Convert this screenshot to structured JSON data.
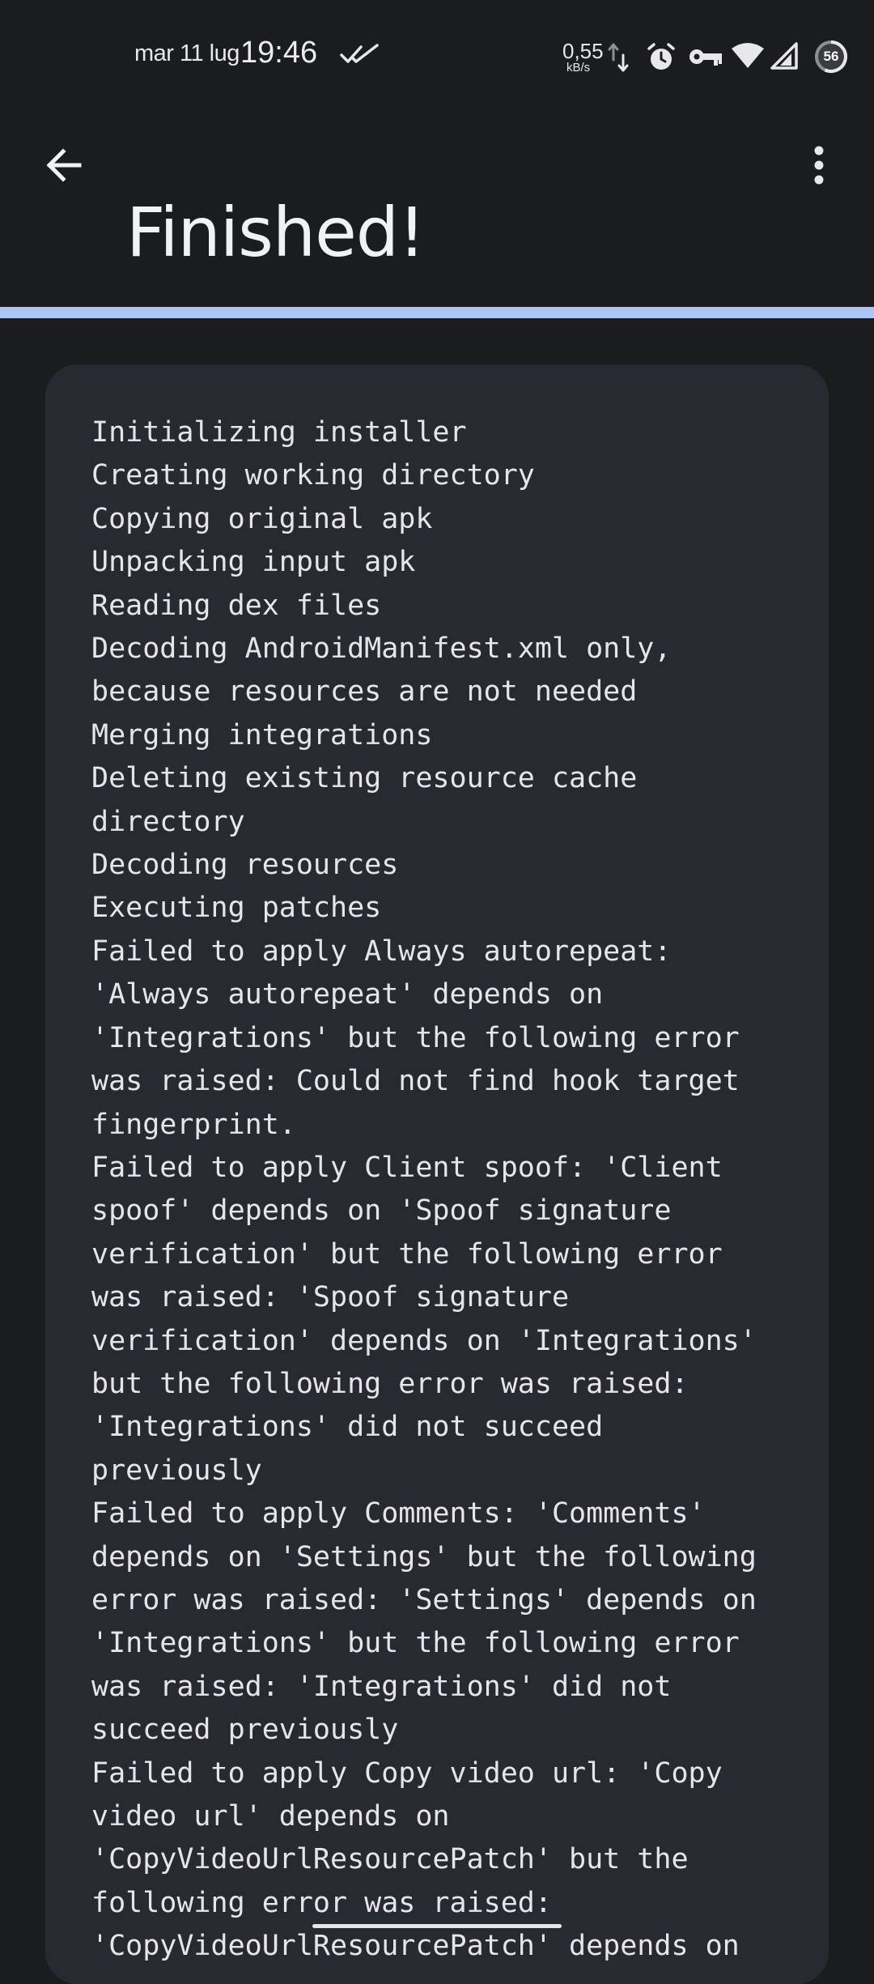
{
  "status_bar": {
    "date": "mar 11 lug",
    "time": "19:46",
    "net_speed_value": "0,55",
    "net_speed_unit": "kB/s",
    "battery_level": "56",
    "icons": [
      "double-check-icon",
      "upload-download-arrows-icon",
      "alarm-icon",
      "vpn-key-icon",
      "wifi-icon",
      "cell-signal-icon",
      "battery-icon"
    ]
  },
  "top_bar": {
    "back_icon": "arrow-back-icon",
    "menu_icon": "more-vert-icon",
    "title": "Finished!"
  },
  "progress": {
    "value": 1.0,
    "fill_color": "#aec6f4"
  },
  "log": {
    "lines": [
      "Initializing installer",
      "Creating working directory",
      "Copying original apk",
      "Unpacking input apk",
      "Reading dex files",
      "Decoding AndroidManifest.xml only,",
      "because resources are not needed",
      "Merging integrations",
      "Deleting existing resource cache",
      "directory",
      "Decoding resources",
      "Executing patches",
      "Failed to apply Always autorepeat:",
      "'Always autorepeat' depends on",
      "'Integrations' but the following error",
      "was raised: Could not find hook target",
      "fingerprint.",
      "Failed to apply Client spoof: 'Client",
      "spoof' depends on 'Spoof signature",
      "verification' but the following error",
      "was raised: 'Spoof signature",
      "verification' depends on 'Integrations'",
      "but the following error was raised:",
      "'Integrations' did not succeed",
      "previously",
      "Failed to apply Comments: 'Comments'",
      "depends on 'Settings' but the following",
      "error was raised: 'Settings' depends on",
      "'Integrations' but the following error",
      "was raised: 'Integrations' did not",
      "succeed previously",
      "Failed to apply Copy video url: 'Copy",
      "video url' depends on",
      "'CopyVideoUrlResourcePatch' but the",
      "following error was raised:",
      "'CopyVideoUrlResourcePatch' depends on"
    ]
  },
  "colors": {
    "background": "#1b1c1e",
    "card": "#272a30",
    "text": "#e4e6ea",
    "accent": "#aec6f4"
  }
}
